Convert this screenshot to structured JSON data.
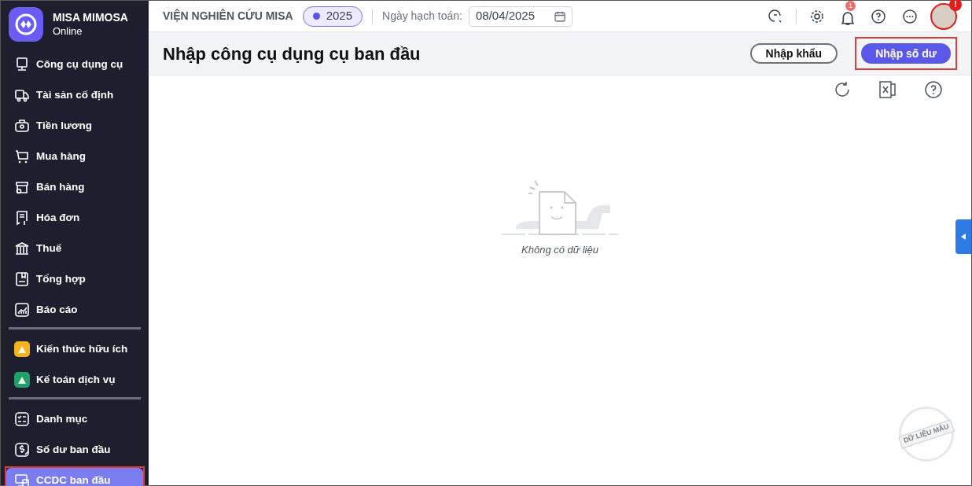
{
  "app": {
    "name": "MISA MIMOSA",
    "subtitle": "Online"
  },
  "sidebar": {
    "sections": [
      {
        "items": [
          {
            "label": "Công cụ dụng cụ",
            "selected": false,
            "annotated": false
          },
          {
            "label": "Tài sản cố định",
            "selected": false,
            "annotated": false
          },
          {
            "label": "Tiền lương",
            "selected": false,
            "annotated": false
          },
          {
            "label": "Mua hàng",
            "selected": false,
            "annotated": false
          },
          {
            "label": "Bán hàng",
            "selected": false,
            "annotated": false
          },
          {
            "label": "Hóa đơn",
            "selected": false,
            "annotated": false
          },
          {
            "label": "Thuế",
            "selected": false,
            "annotated": false
          },
          {
            "label": "Tổng hợp",
            "selected": false,
            "annotated": false
          },
          {
            "label": "Báo cáo",
            "selected": false,
            "annotated": false
          }
        ]
      },
      {
        "items": [
          {
            "label": "Kiến thức hữu ích",
            "selected": false,
            "annotated": false,
            "color": "#f5b41e"
          },
          {
            "label": "Kế toán dịch vụ",
            "selected": false,
            "annotated": false,
            "color": "#22a06b"
          }
        ]
      },
      {
        "items": [
          {
            "label": "Danh mục",
            "selected": false,
            "annotated": false
          },
          {
            "label": "Số dư ban đầu",
            "selected": false,
            "annotated": false
          },
          {
            "label": "CCDC ban đầu",
            "selected": true,
            "annotated": true
          }
        ]
      }
    ]
  },
  "topbar": {
    "organization": "VIỆN NGHIÊN CỨU MISA",
    "year": "2025",
    "date_label": "Ngày hạch toán:",
    "date_value": "08/04/2025",
    "notification_count": "1",
    "avatar_alert": "!"
  },
  "page": {
    "title": "Nhập công cụ dụng cụ ban đầu",
    "buttons": [
      {
        "label": "Nhập khẩu",
        "kind": "outline",
        "annotated": false
      },
      {
        "label": "Nhập số dư",
        "kind": "primary",
        "annotated": true
      }
    ],
    "empty_text": "Không có dữ liệu",
    "stamp": "DỮ LIỆU MẪU"
  }
}
